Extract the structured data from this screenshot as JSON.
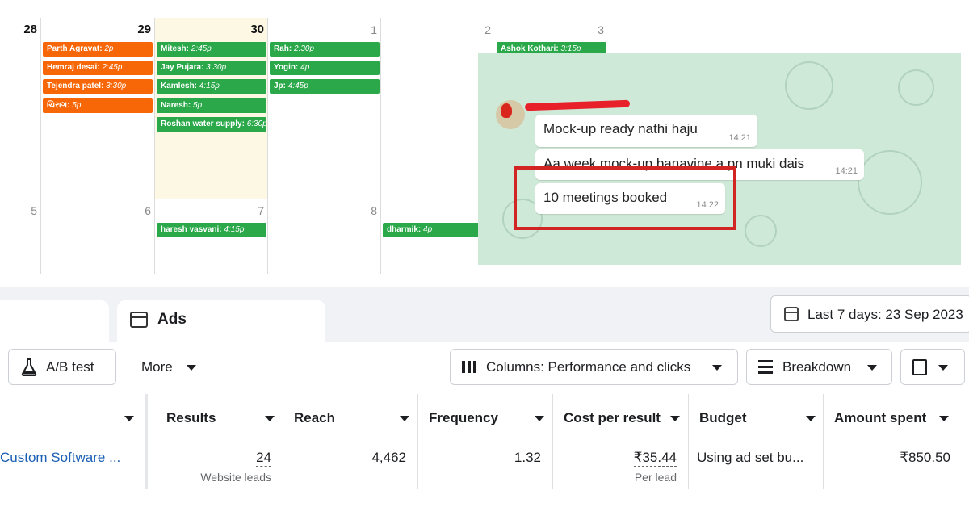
{
  "calendar": {
    "week1_days": [
      "28",
      "29",
      "30",
      "1",
      "2",
      "3"
    ],
    "week2_days": [
      "5",
      "6",
      "7",
      "8"
    ],
    "events": [
      {
        "name": "Parth Agravat:",
        "time": "2p"
      },
      {
        "name": "Hemraj desai:",
        "time": "2:45p"
      },
      {
        "name": "Tejendra patel:",
        "time": "3:30p"
      },
      {
        "name": "ચિરાગ:",
        "time": "5p"
      },
      {
        "name": "Mitesh:",
        "time": "2:45p"
      },
      {
        "name": "Jay Pujara:",
        "time": "3:30p"
      },
      {
        "name": "Kamlesh:",
        "time": "4:15p"
      },
      {
        "name": "Naresh:",
        "time": "5p"
      },
      {
        "name": "Roshan water supply:",
        "time": "6:30p"
      },
      {
        "name": "Rah:",
        "time": "2:30p"
      },
      {
        "name": "Yogin:",
        "time": "4p"
      },
      {
        "name": "Jp:",
        "time": "4:45p"
      },
      {
        "name": "Ashok Kothari:",
        "time": "3:15p"
      },
      {
        "name": "haresh vasvani:",
        "time": "4:15p"
      },
      {
        "name": "dharmik:",
        "time": "4p"
      }
    ]
  },
  "chat": {
    "messages": [
      {
        "text": "Mock-up ready nathi haju",
        "time": "14:21"
      },
      {
        "text": "Aa week mock-up banavine a pn muki dais",
        "time": "14:21"
      },
      {
        "text": "10 meetings booked",
        "time": "14:22"
      }
    ]
  },
  "ads": {
    "tab_label": "Ads",
    "date_range": "Last 7 days: 23 Sep 2023",
    "toolbar": {
      "ab_test": "A/B test",
      "more": "More",
      "columns": "Columns: Performance and clicks",
      "breakdown": "Breakdown"
    },
    "headers": [
      "Results",
      "Reach",
      "Frequency",
      "Cost per result",
      "Budget",
      "Amount spent"
    ],
    "row": {
      "name": "Custom Software ...",
      "results": "24",
      "results_sub": "Website leads",
      "reach": "4,462",
      "frequency": "1.32",
      "cost_per_result": "₹35.44",
      "cost_sub": "Per lead",
      "budget": "Using ad set bu...",
      "amount_spent": "₹850.50"
    }
  },
  "icons": [
    "flask-icon",
    "columns-icon",
    "breakdown-icon",
    "reports-icon",
    "calendar-icon",
    "ads-icon"
  ],
  "colors": {
    "orange_event": "#f76707",
    "green_event": "#2aa84a",
    "chat_bg": "#cfe9d8",
    "highlight": "#d32424",
    "link": "#1a5fb4"
  }
}
